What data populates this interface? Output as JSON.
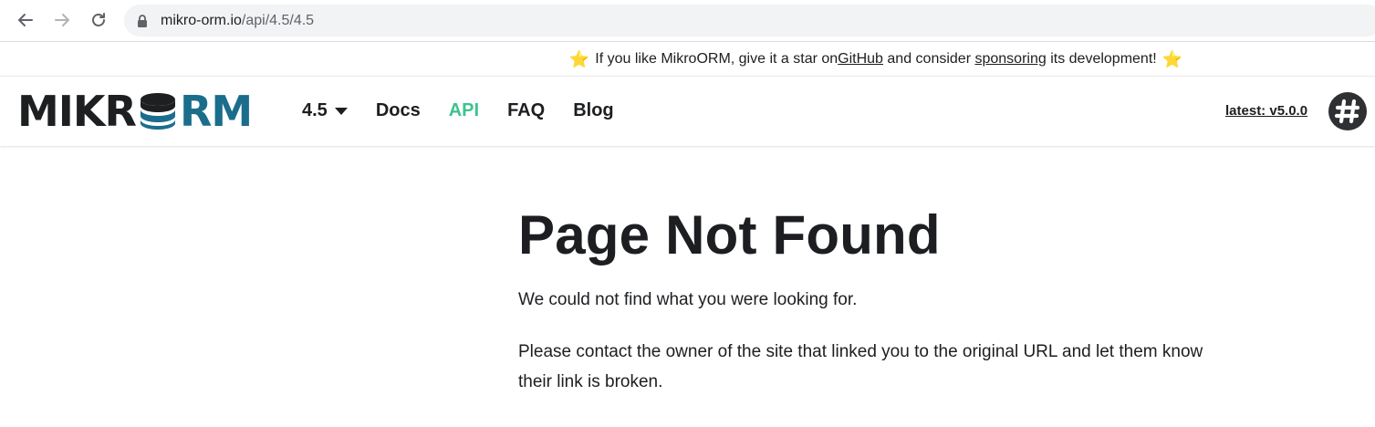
{
  "browser": {
    "url_host": "mikro-orm.io",
    "url_path": "/api/4.5/4.5"
  },
  "announcement": {
    "star_left": "⭐",
    "text_before": "If you like MikroORM, give it a star on ",
    "github_link": "GitHub",
    "text_middle": " and consider ",
    "sponsor_link": "sponsoring",
    "text_after": " its development!",
    "star_right": "⭐"
  },
  "navbar": {
    "logo": {
      "part1": "MIKR",
      "part2": "RM",
      "brand_dark": "#1d1f21",
      "brand_blue": "#1b6d8c"
    },
    "version_dropdown": "4.5",
    "items": [
      {
        "label": "Docs",
        "active": false
      },
      {
        "label": "API",
        "active": true
      },
      {
        "label": "FAQ",
        "active": false
      },
      {
        "label": "Blog",
        "active": false
      }
    ],
    "latest_link": "latest: v5.0.0",
    "slack_icon": "slack-icon",
    "active_color": "#3ec28f"
  },
  "main": {
    "title": "Page Not Found",
    "paragraph_1": "We could not find what you were looking for.",
    "paragraph_2": "Please contact the owner of the site that linked you to the original URL and let them know their link is broken."
  }
}
